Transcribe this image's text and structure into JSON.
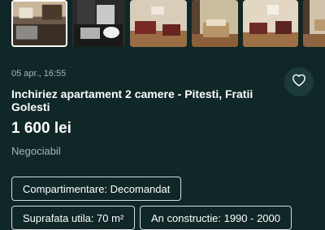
{
  "gallery": {
    "thumbnails": [
      {
        "name": "photo-kitchen",
        "selected": true
      },
      {
        "name": "photo-bathroom",
        "selected": false
      },
      {
        "name": "photo-living-room",
        "selected": false
      },
      {
        "name": "photo-bedroom",
        "selected": false
      },
      {
        "name": "photo-living-room-2",
        "selected": false
      },
      {
        "name": "photo-room",
        "selected": false
      }
    ]
  },
  "listing": {
    "date": "05 apr., 16:55",
    "title": "Inchiriez apartament 2 camere - Pitesti, Fratii Golesti",
    "price": "1 600 lei",
    "negotiable": "Negociabil",
    "favorite_icon": "heart-icon"
  },
  "tags": [
    "Compartimentare: Decomandat",
    "Suprafata utila: 70 m²",
    "An constructie: 1990 - 2000"
  ],
  "colors": {
    "background": "#0f2726",
    "button_bg": "#1d3a3a",
    "muted_text": "#a9b3b3",
    "tag_border": "#d5dcdc"
  }
}
